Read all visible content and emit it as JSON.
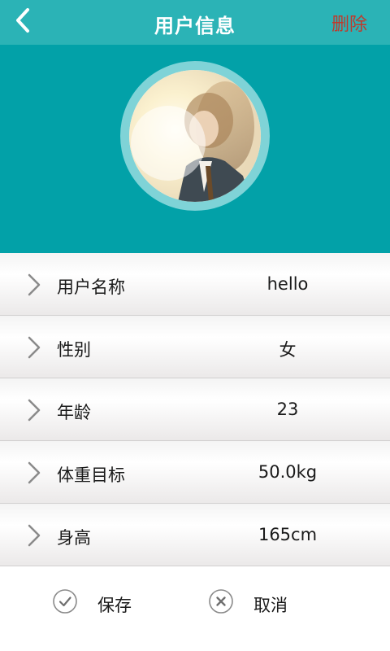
{
  "header": {
    "title": "用户信息",
    "delete_label": "删除",
    "back_icon": "chevron-left-icon"
  },
  "profile": {
    "avatar": "user-avatar-photo"
  },
  "fields": [
    {
      "label": "用户名称",
      "value": "hello"
    },
    {
      "label": "性别",
      "value": "女"
    },
    {
      "label": "年龄",
      "value": "23"
    },
    {
      "label": "体重目标",
      "value": "50.0kg"
    },
    {
      "label": "身高",
      "value": "165cm"
    }
  ],
  "footer": {
    "save_label": "保存",
    "save_icon": "check-circle-icon",
    "cancel_label": "取消",
    "cancel_icon": "close-circle-icon"
  },
  "colors": {
    "topbar": "#2bb3b6",
    "header": "#02a1a8",
    "avatar_ring": "#7fd3d7",
    "delete": "#c0392b"
  }
}
